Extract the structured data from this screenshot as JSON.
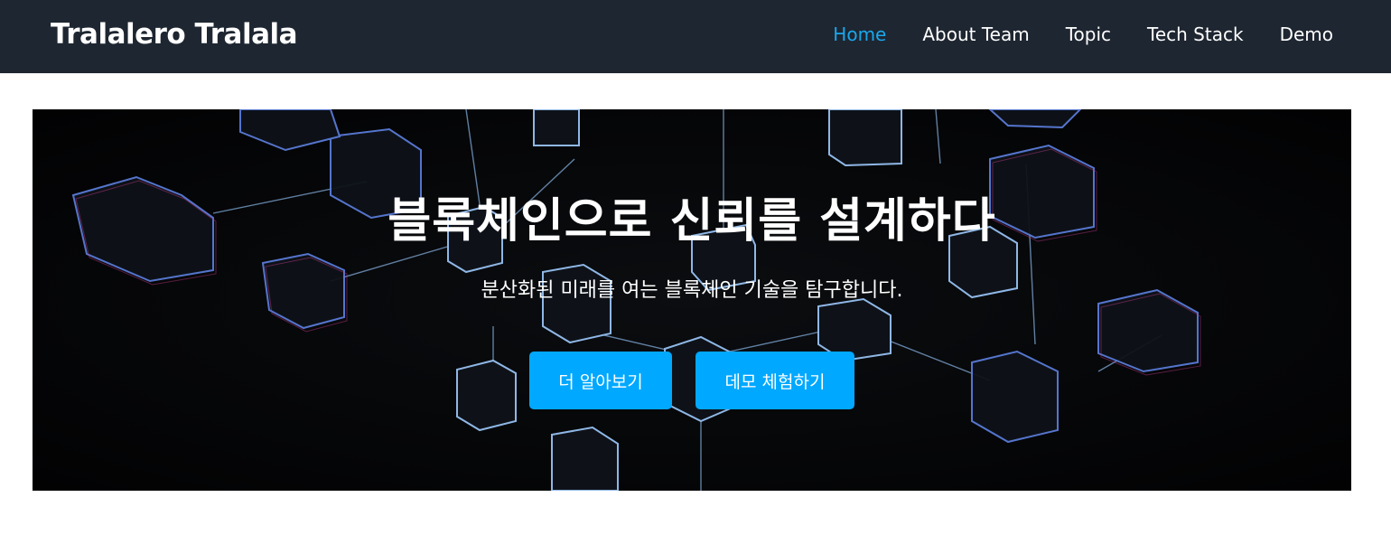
{
  "navbar": {
    "brand": "Tralalero Tralala",
    "links": [
      {
        "label": "Home",
        "active": true
      },
      {
        "label": "About Team",
        "active": false
      },
      {
        "label": "Topic",
        "active": false
      },
      {
        "label": "Tech Stack",
        "active": false
      },
      {
        "label": "Demo",
        "active": false
      }
    ]
  },
  "hero": {
    "title": "블록체인으로 신뢰를 설계하다",
    "subtitle": "분산화된 미래를 여는 블록체인 기술을 탐구합니다.",
    "learn_more_label": "더 알아보기",
    "demo_label": "데모 체험하기"
  },
  "colors": {
    "navbar_bg": "#1e2631",
    "accent": "#00a8ff",
    "active_link": "#1aa7ec",
    "hero_bg": "#040506"
  }
}
